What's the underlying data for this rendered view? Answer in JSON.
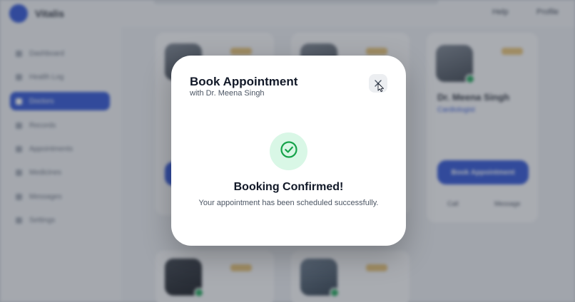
{
  "app": {
    "brand": "Vitalis",
    "top_links": [
      "Help",
      "Profile"
    ]
  },
  "sidebar": {
    "items": [
      {
        "label": "Dashboard",
        "active": false
      },
      {
        "label": "Health Log",
        "active": false
      },
      {
        "label": "Doctors",
        "active": true
      },
      {
        "label": "Records",
        "active": false
      },
      {
        "label": "Appointments",
        "active": false
      },
      {
        "label": "Medicines",
        "active": false
      },
      {
        "label": "Messages",
        "active": false
      },
      {
        "label": "Settings",
        "active": false
      }
    ]
  },
  "background_card": {
    "name": "Dr. Meena Singh",
    "specialty": "Cardiologist",
    "book_label": "Book Appointment",
    "actions": [
      "Call",
      "Message"
    ]
  },
  "modal": {
    "title": "Book Appointment",
    "subtitle": "with Dr. Meena Singh",
    "close_icon": "close-icon",
    "success_icon": "check-circle-icon",
    "success_title": "Booking Confirmed!",
    "success_message": "Your appointment has been scheduled successfully."
  },
  "colors": {
    "accent": "#2f54d6",
    "success": "#16a34a",
    "success_bg": "#d9f7e6"
  }
}
